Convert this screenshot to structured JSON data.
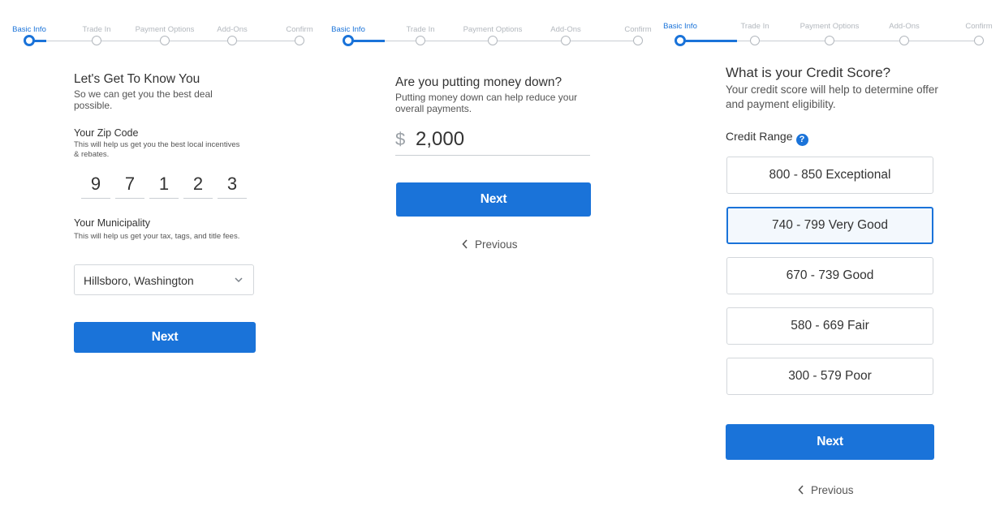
{
  "stepper": {
    "steps": [
      "Basic Info",
      "Trade In",
      "Payment Options",
      "Add-Ons",
      "Confirm"
    ],
    "active_step": "Basic Info"
  },
  "panel1": {
    "title": "Let's Get To Know You",
    "subtitle": "So we can get you the best deal possible.",
    "zip": {
      "label": "Your Zip Code",
      "help": "This will help us get you the best local incentives & rebates.",
      "digits": [
        "9",
        "7",
        "1",
        "2",
        "3"
      ]
    },
    "municipality": {
      "label": "Your Municipality",
      "help": "This will help us get your tax, tags, and title fees.",
      "value": "Hillsboro, Washington"
    },
    "next_label": "Next"
  },
  "panel2": {
    "title": "Are you putting money down?",
    "subtitle": "Putting money down can help reduce your overall payments.",
    "currency_symbol": "$",
    "amount": "2,000",
    "next_label": "Next",
    "previous_label": "Previous"
  },
  "panel3": {
    "title": "What is your Credit Score?",
    "subtitle": "Your credit score will help to determine offer and payment eligibility.",
    "range_label": "Credit Range",
    "help_icon_glyph": "?",
    "options": [
      {
        "label": "800 - 850 Exceptional",
        "selected": false
      },
      {
        "label": "740 - 799 Very Good",
        "selected": true
      },
      {
        "label": "670 - 739 Good",
        "selected": false
      },
      {
        "label": "580 - 669 Fair",
        "selected": false
      },
      {
        "label": "300 - 579 Poor",
        "selected": false
      }
    ],
    "next_label": "Next",
    "previous_label": "Previous"
  },
  "colors": {
    "accent": "#1a73d9",
    "inactive": "#b3b8be",
    "selected_bg": "#f3f8fd"
  }
}
